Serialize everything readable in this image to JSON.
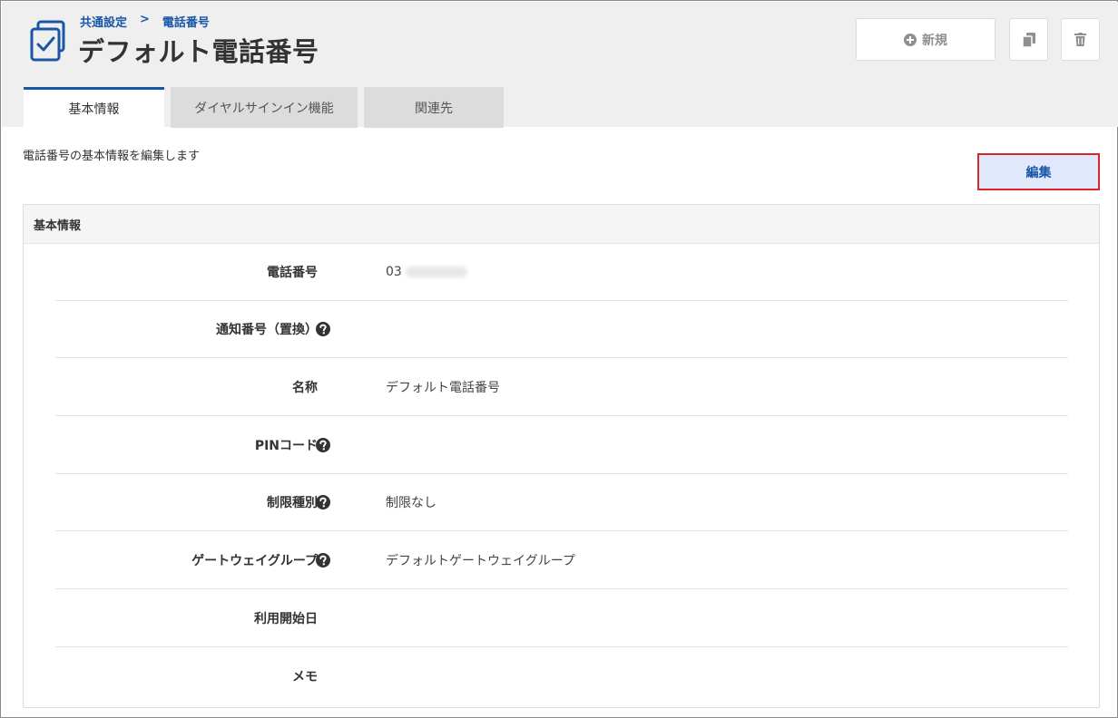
{
  "breadcrumb": {
    "parent": "共通設定",
    "separator": ">",
    "current": "電話番号"
  },
  "page": {
    "title": "デフォルト電話番号",
    "icon": "checkbox-document-icon"
  },
  "toolbar": {
    "new_label": "新規",
    "new_icon": "plus-circle-icon",
    "copy_icon": "copy-icon",
    "delete_icon": "trash-icon"
  },
  "tabs": [
    {
      "label": "基本情報",
      "active": true
    },
    {
      "label": "ダイヤルサインイン機能",
      "active": false
    },
    {
      "label": "関連先",
      "active": false
    }
  ],
  "description": "電話番号の基本情報を編集します",
  "edit_button": {
    "label": "編集"
  },
  "panel": {
    "title": "基本情報",
    "rows": [
      {
        "label": "電話番号",
        "value_prefix": "03",
        "help": false,
        "masked": true
      },
      {
        "label": "通知番号（置換）",
        "value": "",
        "help": true
      },
      {
        "label": "名称",
        "value": "デフォルト電話番号",
        "help": false
      },
      {
        "label": "PINコード",
        "value": "",
        "help": true
      },
      {
        "label": "制限種別",
        "value": "制限なし",
        "help": true
      },
      {
        "label": "ゲートウェイグループ",
        "value": "デフォルトゲートウェイグループ",
        "help": true
      },
      {
        "label": "利用開始日",
        "value": "",
        "help": false
      },
      {
        "label": "メモ",
        "value": "",
        "help": false
      }
    ]
  },
  "colors": {
    "accent": "#1a56a8",
    "highlight_border": "#d9262b",
    "edit_bg": "#dfe9fb"
  }
}
